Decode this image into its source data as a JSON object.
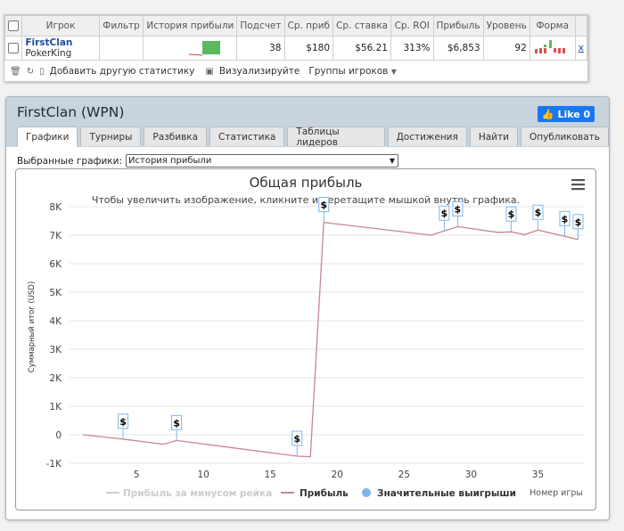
{
  "stats": {
    "headers": [
      "Игрок",
      "Фильтр",
      "История прибыли",
      "Подсчет",
      "Ср. приб",
      "Ср. ставка",
      "Ср. ROI",
      "Прибыль",
      "Уровень",
      "Форма"
    ],
    "row": {
      "player_name": "FirstClan",
      "site": "PokerKing",
      "count": "38",
      "avg_profit": "$180",
      "avg_stake": "$56.21",
      "avg_roi": "313%",
      "profit": "$6,853",
      "level": "92",
      "remove": "x"
    },
    "toolbar": {
      "add_stats": "Добавить другую статистику",
      "visualize": "Визуализируйте",
      "player_groups": "Группы игроков"
    }
  },
  "panel": {
    "title": "FirstClan (WPN)",
    "like_label": "Like 0",
    "tabs": [
      "Графики",
      "Турниры",
      "Разбивка",
      "Статистика",
      "Таблицы лидеров",
      "Достижения",
      "Найти",
      "Опубликовать"
    ],
    "active_tab": "Графики",
    "select_label": "Выбранные графики:",
    "select_value": "История прибыли"
  },
  "chart_data": {
    "type": "line",
    "title": "Общая прибыль",
    "subtitle": "Чтобы увеличить изображение, кликните и перетащите мышкой внутрь графика.",
    "ylabel": "Суммарный итог (USD)",
    "xlabel": "Номер игры",
    "xlim": [
      0,
      38.5
    ],
    "ylim": [
      -1000,
      8000
    ],
    "xticks": [
      5,
      10,
      15,
      20,
      25,
      30,
      35
    ],
    "yticks": [
      -1000,
      0,
      1000,
      2000,
      3000,
      4000,
      5000,
      6000,
      7000,
      8000
    ],
    "ytick_labels": [
      "-1K",
      "0",
      "1K",
      "2K",
      "3K",
      "4K",
      "5K",
      "6K",
      "7K",
      "8K"
    ],
    "series": [
      {
        "name": "Прибыль",
        "color": "#c9858f",
        "x": [
          1,
          4,
          7,
          8,
          17,
          18,
          19,
          27,
          29,
          32,
          33,
          34,
          35,
          36,
          37,
          38
        ],
        "y": [
          0,
          -150,
          -330,
          -200,
          -750,
          -770,
          7450,
          7000,
          7300,
          7100,
          7120,
          7020,
          7180,
          7070,
          6960,
          6850
        ]
      }
    ],
    "big_wins": [
      {
        "x": 4,
        "y": -150
      },
      {
        "x": 8,
        "y": -200
      },
      {
        "x": 17,
        "y": -750
      },
      {
        "x": 19,
        "y": 7450
      },
      {
        "x": 28,
        "y": 7150
      },
      {
        "x": 29,
        "y": 7300
      },
      {
        "x": 33,
        "y": 7120
      },
      {
        "x": 35,
        "y": 7180
      },
      {
        "x": 37,
        "y": 6960
      },
      {
        "x": 38,
        "y": 6850
      }
    ],
    "legend": [
      "Прибыль за минусом рейка",
      "Прибыль",
      "Значительные выигрыши"
    ],
    "legend_colors": [
      "#cccccc",
      "#c9858f",
      "#7cb5ec"
    ],
    "legend_position": "bottom"
  }
}
